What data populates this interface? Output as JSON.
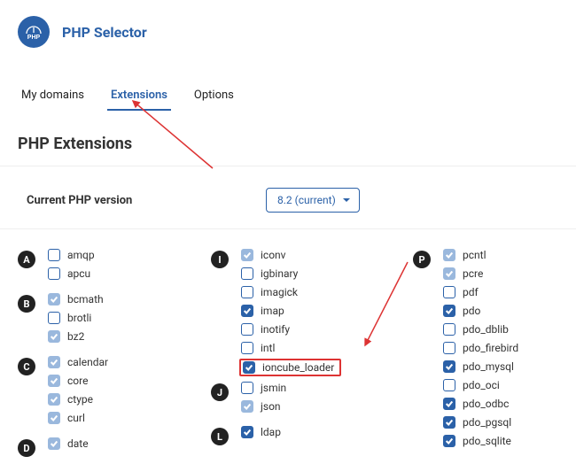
{
  "header": {
    "title": "PHP Selector"
  },
  "tabs": [
    {
      "label": "My domains",
      "active": false
    },
    {
      "label": "Extensions",
      "active": true
    },
    {
      "label": "Options",
      "active": false
    }
  ],
  "section_title": "PHP Extensions",
  "version": {
    "label": "Current PHP version",
    "selected": "8.2 (current)"
  },
  "columns": [
    {
      "groups": [
        {
          "letter": "A",
          "items": [
            {
              "name": "amqp",
              "checked": false
            },
            {
              "name": "apcu",
              "checked": false
            }
          ]
        },
        {
          "letter": "B",
          "items": [
            {
              "name": "bcmath",
              "checked": true,
              "light": true
            },
            {
              "name": "brotli",
              "checked": false
            },
            {
              "name": "bz2",
              "checked": true,
              "light": true
            }
          ]
        },
        {
          "letter": "C",
          "items": [
            {
              "name": "calendar",
              "checked": true,
              "light": true
            },
            {
              "name": "core",
              "checked": true,
              "light": true
            },
            {
              "name": "ctype",
              "checked": true,
              "light": true
            },
            {
              "name": "curl",
              "checked": true,
              "light": true
            }
          ]
        },
        {
          "letter": "D",
          "items": [
            {
              "name": "date",
              "checked": true,
              "light": true
            }
          ]
        }
      ]
    },
    {
      "groups": [
        {
          "letter": "I",
          "items": [
            {
              "name": "iconv",
              "checked": true,
              "light": true
            },
            {
              "name": "igbinary",
              "checked": false
            },
            {
              "name": "imagick",
              "checked": false
            },
            {
              "name": "imap",
              "checked": true
            },
            {
              "name": "inotify",
              "checked": false
            },
            {
              "name": "intl",
              "checked": false
            },
            {
              "name": "ioncube_loader",
              "checked": true,
              "highlight": true
            }
          ]
        },
        {
          "letter": "J",
          "items": [
            {
              "name": "jsmin",
              "checked": false
            },
            {
              "name": "json",
              "checked": true,
              "light": true
            }
          ]
        },
        {
          "letter": "L",
          "items": [
            {
              "name": "ldap",
              "checked": true
            }
          ]
        }
      ]
    },
    {
      "groups": [
        {
          "letter": "P",
          "items": [
            {
              "name": "pcntl",
              "checked": true,
              "light": true
            },
            {
              "name": "pcre",
              "checked": true,
              "light": true
            },
            {
              "name": "pdf",
              "checked": false
            },
            {
              "name": "pdo",
              "checked": true
            },
            {
              "name": "pdo_dblib",
              "checked": false
            },
            {
              "name": "pdo_firebird",
              "checked": false
            },
            {
              "name": "pdo_mysql",
              "checked": true
            },
            {
              "name": "pdo_oci",
              "checked": false
            },
            {
              "name": "pdo_odbc",
              "checked": true
            },
            {
              "name": "pdo_pgsql",
              "checked": true
            },
            {
              "name": "pdo_sqlite",
              "checked": true
            }
          ]
        }
      ]
    }
  ]
}
